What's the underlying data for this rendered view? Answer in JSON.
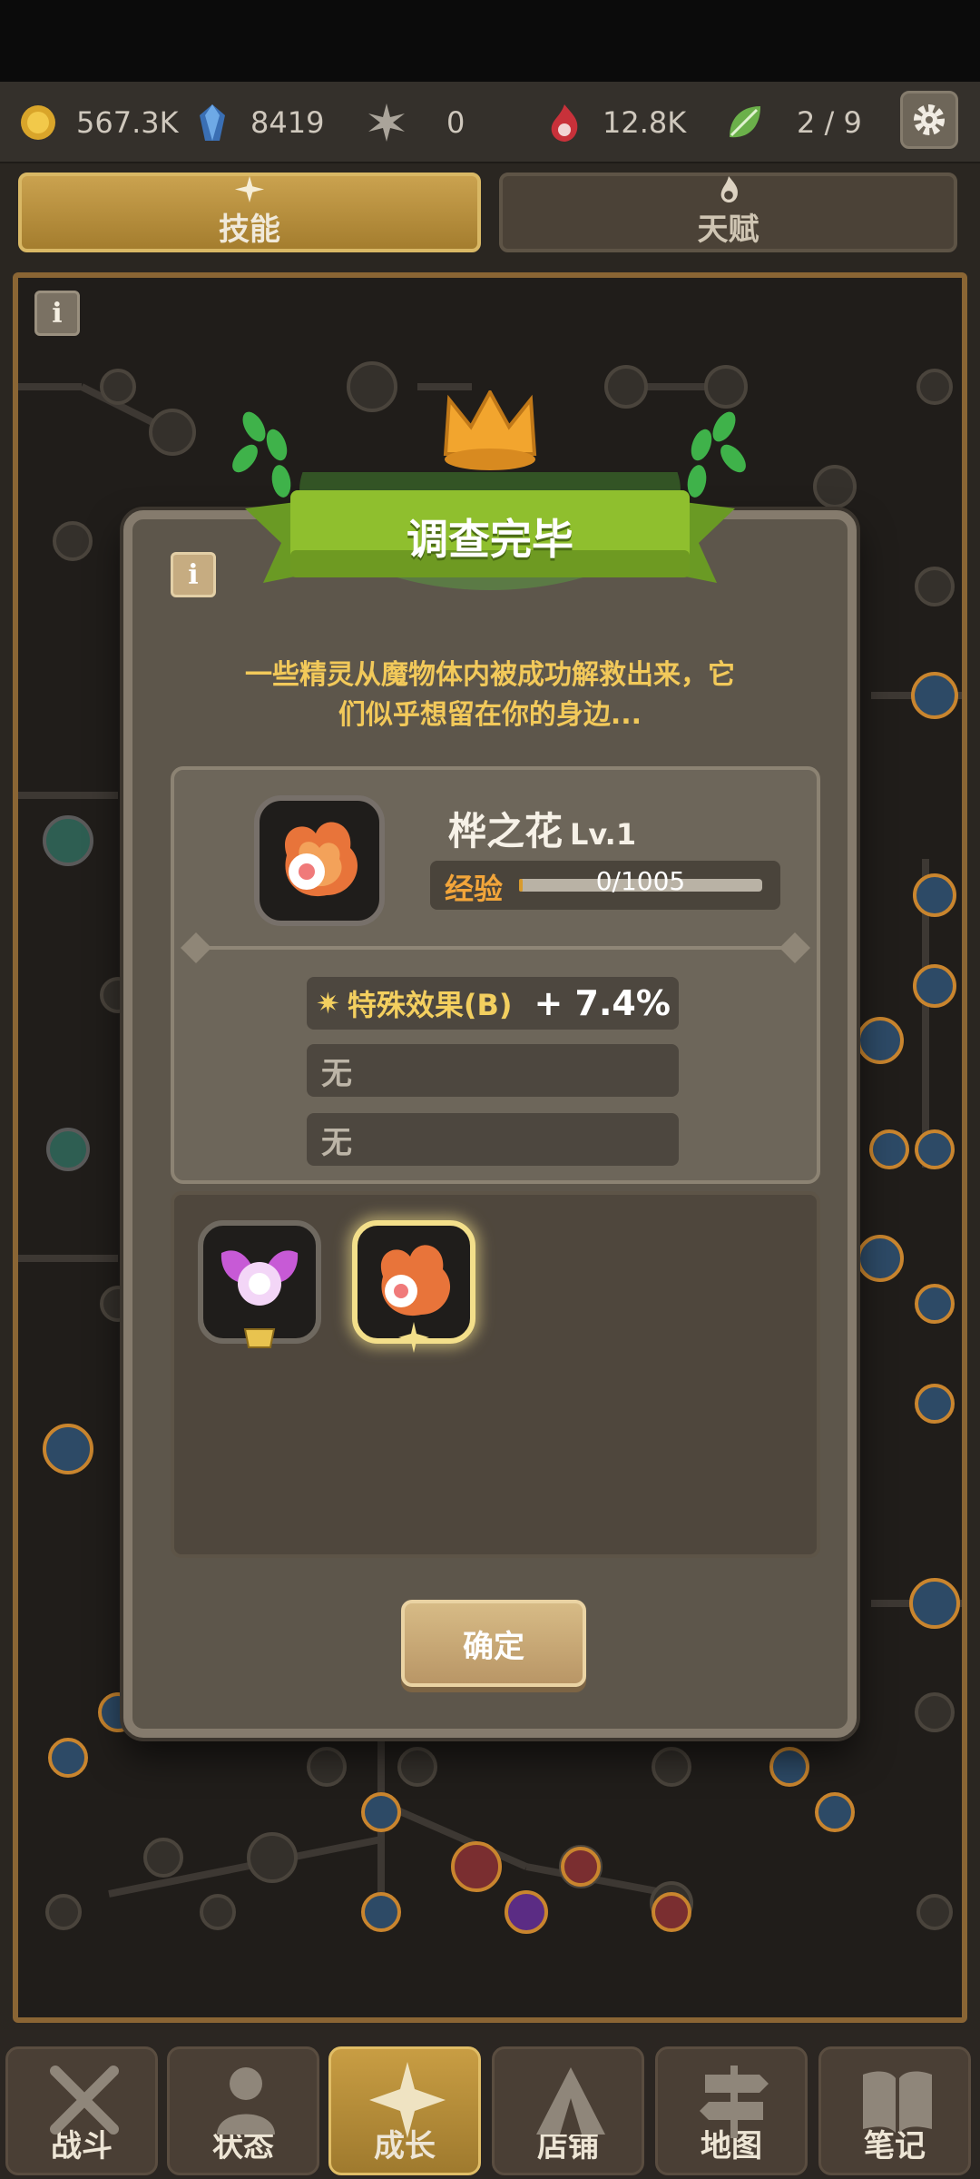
{
  "resources": [
    {
      "icon": "gold-coin-icon",
      "value": "567.3K"
    },
    {
      "icon": "blue-crystal-icon",
      "value": "8419"
    },
    {
      "icon": "star-burst-icon",
      "value": "0"
    },
    {
      "icon": "red-flame-icon",
      "value": "12.8K"
    },
    {
      "icon": "green-leaf-icon",
      "value": "2 / 9"
    }
  ],
  "tabs": [
    {
      "label": "技能",
      "icon": "sparkle-icon",
      "active": true
    },
    {
      "label": "天赋",
      "icon": "flame-icon",
      "active": false
    }
  ],
  "dialog": {
    "title": "调查完毕",
    "description_line1": "一些精灵从魔物体内被成功解救出来，它",
    "description_line2": "们似乎想留在你的身边...",
    "pet": {
      "name": "桦之花",
      "level": "Lv.1",
      "exp_label": "经验",
      "exp_text": "0/1005",
      "exp_progress": 0.0
    },
    "effects": [
      {
        "name": "特殊效果(B)",
        "value": "+ 7.4%"
      },
      {
        "name": "无"
      },
      {
        "name": "无"
      }
    ],
    "confirm_label": "确定"
  },
  "nav": [
    {
      "label": "战斗",
      "icon": "crossed-swords-icon",
      "active": false
    },
    {
      "label": "状态",
      "icon": "person-icon",
      "active": false
    },
    {
      "label": "成长",
      "icon": "star-icon",
      "active": true
    },
    {
      "label": "店铺",
      "icon": "tent-icon",
      "active": false
    },
    {
      "label": "地图",
      "icon": "signpost-icon",
      "active": false
    },
    {
      "label": "笔记",
      "icon": "book-icon",
      "active": false
    }
  ],
  "colors": {
    "accent_gold": "#caa24f",
    "exp_orange": "#f2a53a",
    "banner_green": "#8fbf2e"
  }
}
